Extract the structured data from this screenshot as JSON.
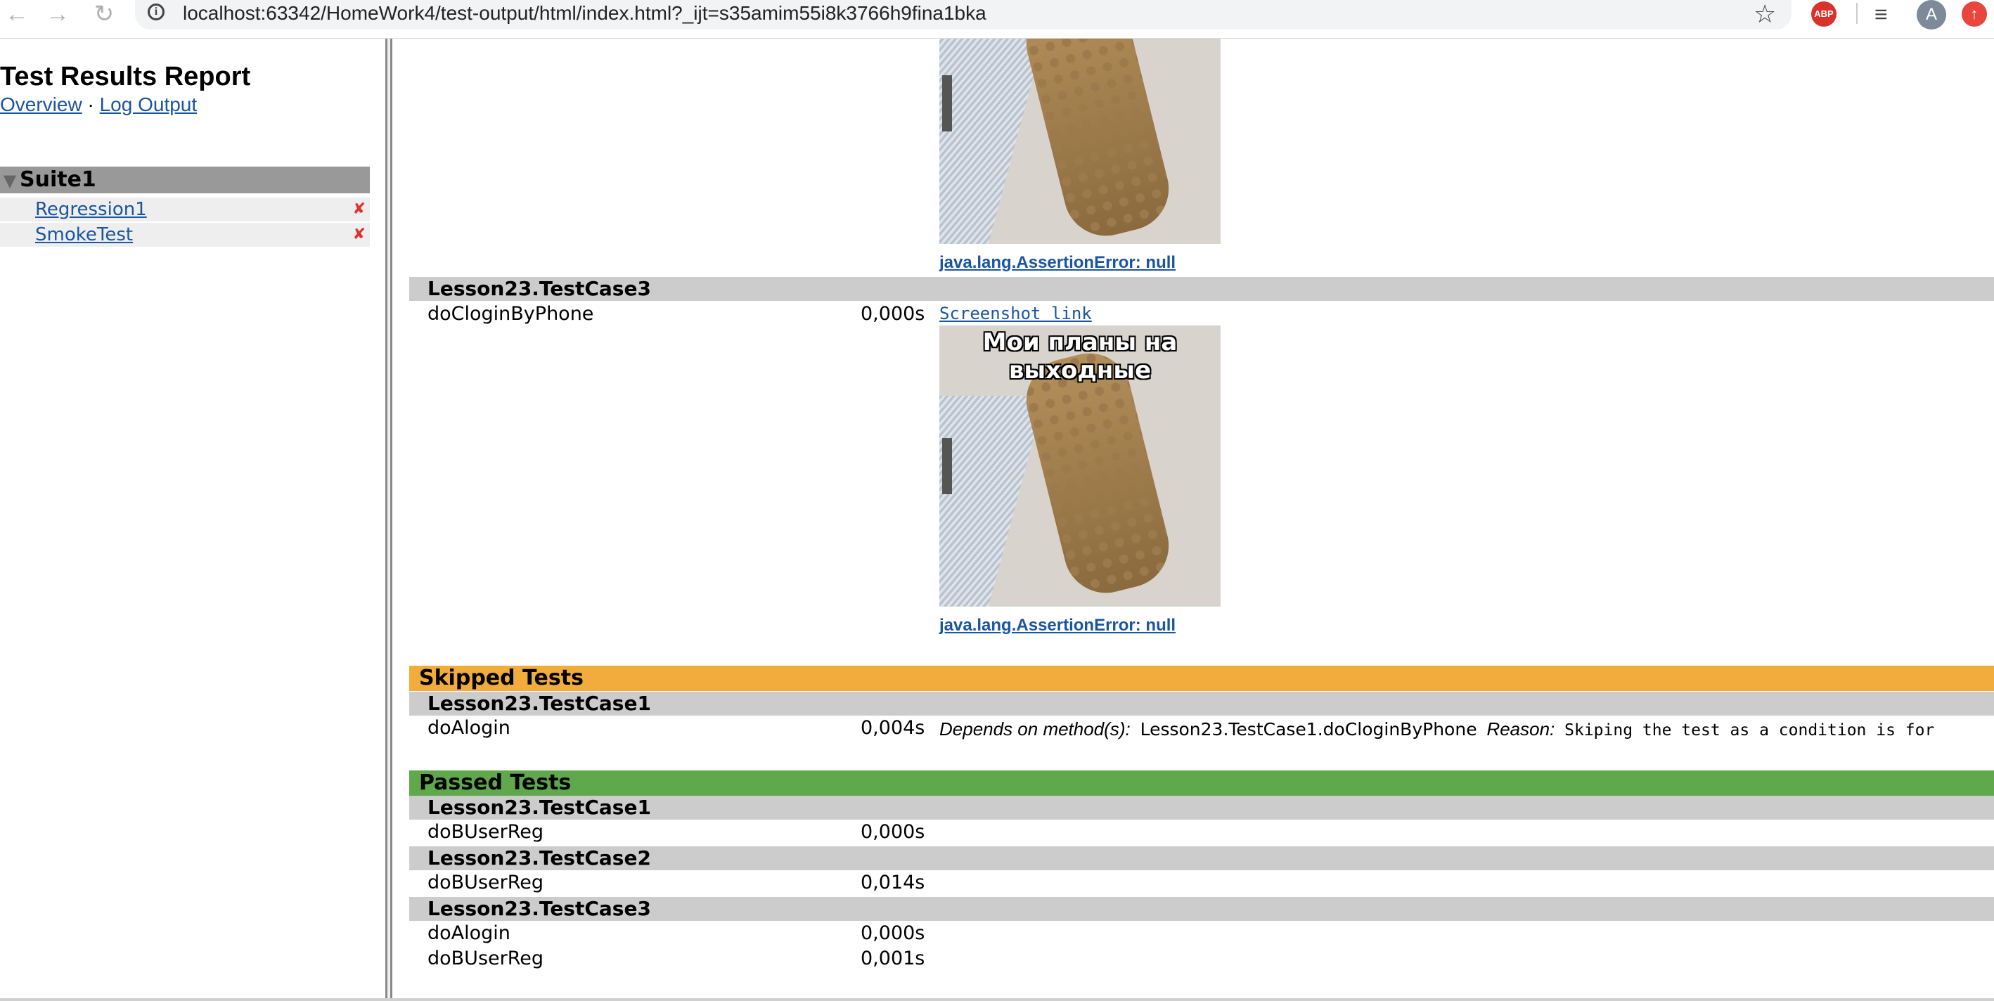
{
  "browser": {
    "url": "localhost:63342/HomeWork4/test-output/html/index.html?_ijt=s35amim55i8k3766h9fina1bka",
    "abp_label": "ABP",
    "avatar_letter": "A",
    "icons": [
      "back-icon",
      "forward-icon",
      "reload-icon",
      "info-icon",
      "star-icon",
      "adblock-icon",
      "queue-icon",
      "avatar",
      "update-icon"
    ]
  },
  "left": {
    "title": "Test Results Report",
    "links": {
      "overview": "Overview",
      "separator": "·",
      "log_output": "Log Output"
    },
    "suite": {
      "name": "Suite1",
      "tests": [
        {
          "name": "Regression1",
          "status": "failed"
        },
        {
          "name": "SmokeTest",
          "status": "failed"
        }
      ]
    }
  },
  "main": {
    "failed_top": {
      "error_link_1": "java.lang.AssertionError: null",
      "class": "Lesson23.TestCase3",
      "test": {
        "name": "doCloginByPhone",
        "duration": "0,000s"
      },
      "screenshot_link": "Screenshot link",
      "image_caption": "Мои планы на выходные",
      "error_link_2": "java.lang.AssertionError: null"
    },
    "skipped": {
      "title": "Skipped Tests",
      "class": "Lesson23.TestCase1",
      "test": {
        "name": "doAlogin",
        "duration": "0,004s"
      },
      "depends_label": "Depends on method(s):",
      "depends_value": "Lesson23.TestCase1.doCloginByPhone",
      "reason_label": "Reason:",
      "reason_value": "Skiping the test as a condition is for"
    },
    "passed": {
      "title": "Passed Tests",
      "groups": [
        {
          "class": "Lesson23.TestCase1",
          "tests": [
            {
              "name": "doBUserReg",
              "duration": "0,000s"
            }
          ]
        },
        {
          "class": "Lesson23.TestCase2",
          "tests": [
            {
              "name": "doBUserReg",
              "duration": "0,014s"
            }
          ]
        },
        {
          "class": "Lesson23.TestCase3",
          "tests": [
            {
              "name": "doAlogin",
              "duration": "0,000s"
            },
            {
              "name": "doBUserReg",
              "duration": "0,001s"
            }
          ]
        }
      ]
    }
  },
  "colors": {
    "skipped_header": "#f2ac3e",
    "passed_header": "#5fa84c",
    "class_row": "#cccccc",
    "link": "#1a55a0",
    "fail_mark": "#e03030"
  }
}
